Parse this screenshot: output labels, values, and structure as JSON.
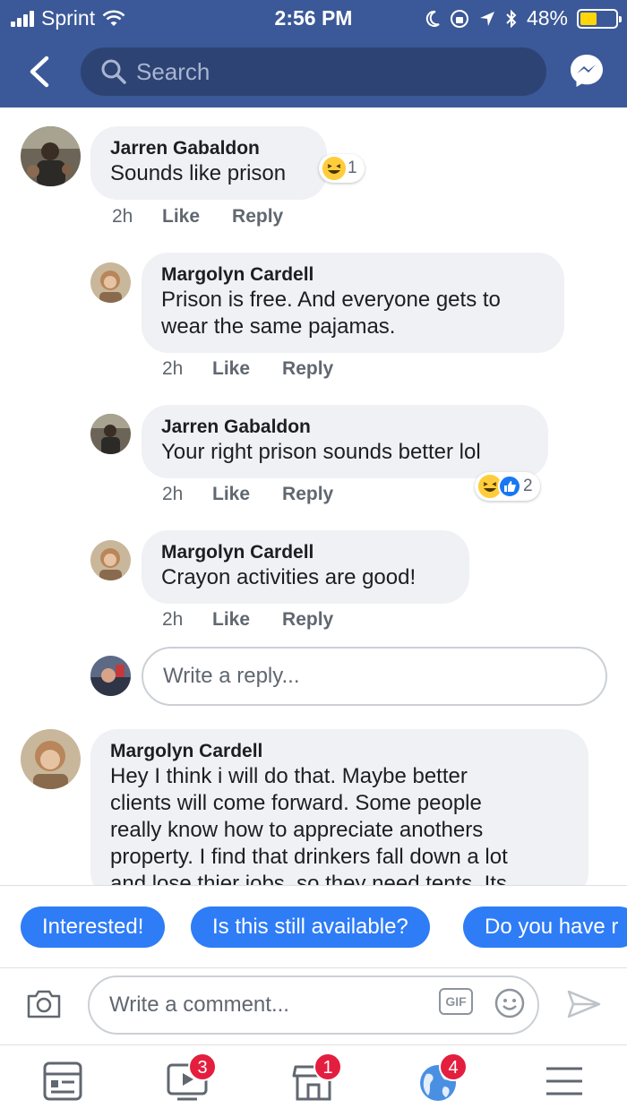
{
  "status_bar": {
    "carrier": "Sprint",
    "time": "2:56 PM",
    "battery": "48%",
    "battery_level": 0.48,
    "icons": [
      "signal-icon",
      "wifi-icon",
      "moon-icon",
      "orientation-lock-icon",
      "location-icon",
      "bluetooth-icon",
      "battery-icon"
    ]
  },
  "header": {
    "search_placeholder": "Search",
    "icons": [
      "back-arrow-icon",
      "search-icon",
      "messenger-icon"
    ],
    "color": "#3b5998"
  },
  "comments": [
    {
      "author": "Jarren Gabaldon",
      "text": "Sounds like prison",
      "time": "2h",
      "like": "Like",
      "reply": "Reply",
      "reaction_count": "1",
      "reactions": [
        "haha-icon"
      ]
    },
    {
      "author": "Margolyn Cardell",
      "text_line1": "Prison is free. And everyone gets to",
      "text_line2": "wear the same pajamas.",
      "time": "2h",
      "like": "Like",
      "reply": "Reply"
    },
    {
      "author": "Jarren Gabaldon",
      "text": "Your right prison sounds better lol",
      "time": "2h",
      "like": "Like",
      "reply": "Reply",
      "reaction_count": "2",
      "reactions": [
        "haha-icon",
        "like-icon"
      ]
    },
    {
      "author": "Margolyn Cardell",
      "text": "Crayon activities are good!",
      "time": "2h",
      "like": "Like",
      "reply": "Reply"
    },
    {
      "author": "Margolyn Cardell",
      "text_lines": [
        "Hey I think i will do that. Maybe better",
        "clients will come forward. Some people",
        "really know how to appreciate anothers",
        "property. I find that drinkers fall down a lot",
        "and lose thier jobs, so they need tents. Its"
      ]
    }
  ],
  "reply_input": {
    "placeholder": "Write a reply..."
  },
  "quick_replies": [
    "Interested!",
    "Is this still available?",
    "Do you have r"
  ],
  "composer": {
    "placeholder": "Write a comment...",
    "gif_label": "GIF",
    "icons": [
      "camera-icon",
      "gif-icon",
      "emoji-icon",
      "send-icon"
    ]
  },
  "bottom_nav": [
    {
      "icon": "news-feed-icon",
      "badge": ""
    },
    {
      "icon": "watch-video-icon",
      "badge": "3"
    },
    {
      "icon": "marketplace-icon",
      "badge": "1"
    },
    {
      "icon": "notifications-globe-icon",
      "badge": "4"
    },
    {
      "icon": "menu-icon",
      "badge": ""
    }
  ],
  "colors": {
    "accent": "#2e7cf6",
    "badge": "#e41e3f",
    "bubble": "#f0f1f4",
    "brand": "#3b5998"
  }
}
